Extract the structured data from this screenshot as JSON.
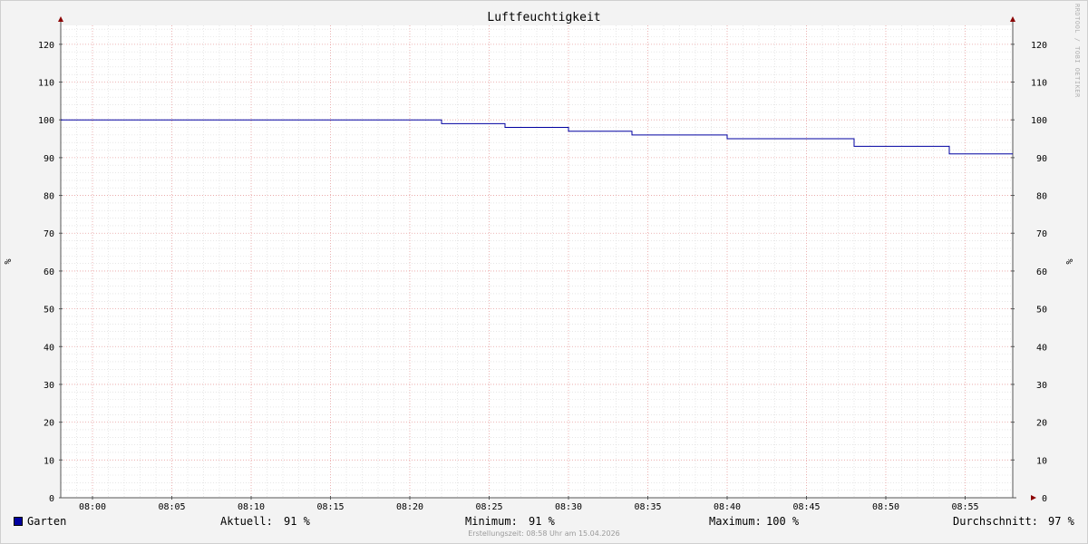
{
  "chart_data": {
    "type": "line",
    "title": "Luftfeuchtigkeit",
    "ylabel_left": "%",
    "ylabel_right": "%",
    "xlabel": "",
    "ylim": [
      0,
      125
    ],
    "xlim": [
      "07:58",
      "08:58"
    ],
    "y_ticks": [
      0,
      10,
      20,
      30,
      40,
      50,
      60,
      70,
      80,
      90,
      100,
      110,
      120
    ],
    "x_ticks": [
      "08:00",
      "08:05",
      "08:10",
      "08:15",
      "08:20",
      "08:25",
      "08:30",
      "08:35",
      "08:40",
      "08:45",
      "08:50",
      "08:55"
    ],
    "grid": true,
    "legend": "bottom-left",
    "series": [
      {
        "name": "Garten",
        "color": "#0000a0",
        "step": true,
        "points": [
          {
            "x": "07:58",
            "y": 100
          },
          {
            "x": "08:22",
            "y": 99
          },
          {
            "x": "08:26",
            "y": 98
          },
          {
            "x": "08:28",
            "y": 98
          },
          {
            "x": "08:30",
            "y": 97
          },
          {
            "x": "08:34",
            "y": 96
          },
          {
            "x": "08:40",
            "y": 95
          },
          {
            "x": "08:48",
            "y": 93
          },
          {
            "x": "08:54",
            "y": 91
          },
          {
            "x": "08:58",
            "y": 91
          }
        ]
      }
    ]
  },
  "legend": {
    "series_name": "Garten",
    "current_label": "Aktuell:",
    "current_value": "91 %",
    "min_label": "Minimum:",
    "min_value": "91 %",
    "max_label": "Maximum:",
    "max_value": "100 %",
    "avg_label": "Durchschnitt:",
    "avg_value": "97 %"
  },
  "footer": "Erstellungszeit: 08:58 Uhr am 15.04.2026",
  "watermark": "RRDTOOL / TOBI OETIKER",
  "colors": {
    "background": "#f3f3f3",
    "canvas": "#ffffff",
    "major_grid": "#e8a0a0",
    "minor_grid": "#d8d8d8",
    "axis": "#555555",
    "arrow": "#8b0000",
    "line": "#0000a0"
  }
}
